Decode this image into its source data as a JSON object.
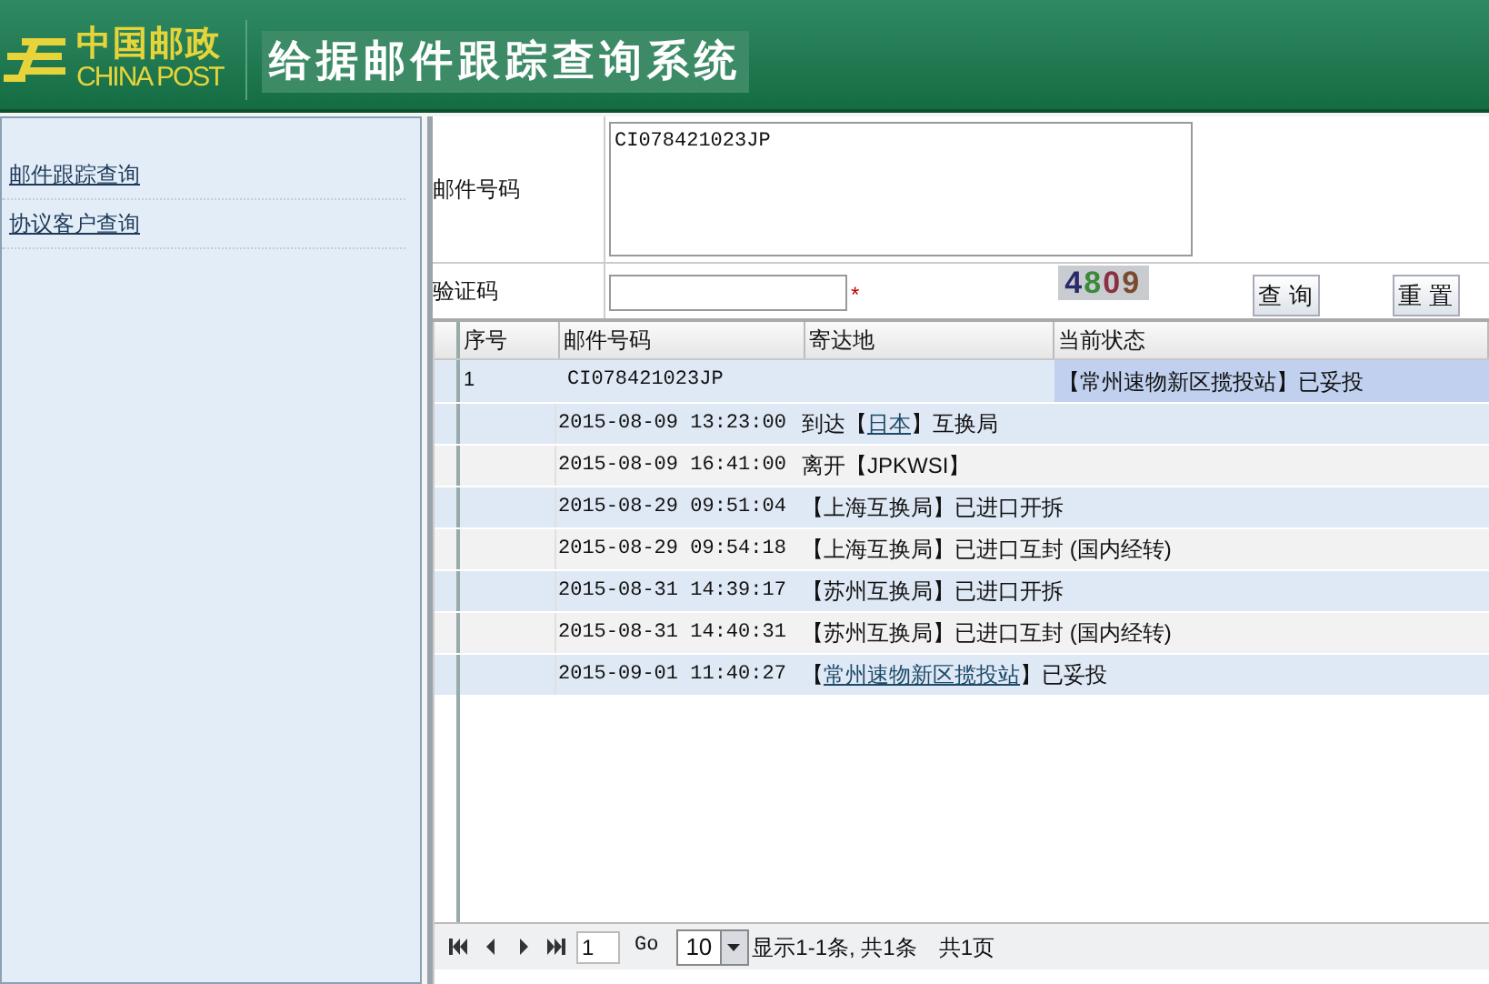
{
  "header": {
    "logo_cn": "中国邮政",
    "logo_en": "CHINA POST",
    "title": "给据邮件跟踪查询系统"
  },
  "sidebar": {
    "items": [
      {
        "label": "邮件跟踪查询"
      },
      {
        "label": "协议客户查询"
      }
    ]
  },
  "form": {
    "mail_label": "邮件号码",
    "mail_value": "CI078421023JP",
    "captcha_label": "验证码",
    "required_mark": "*",
    "captcha_digits": [
      {
        "text": "4",
        "color": "#2a2a6a"
      },
      {
        "text": "8",
        "color": "#3a8a3a"
      },
      {
        "text": "0",
        "color": "#8a3040"
      },
      {
        "text": "9",
        "color": "#7a4a30"
      }
    ],
    "buttons": [
      "查 询",
      "重 置"
    ]
  },
  "table": {
    "columns": [
      "序号",
      "邮件号码",
      "寄达地",
      "当前状态"
    ],
    "row": {
      "index": "1",
      "mail_no": "CI078421023JP",
      "status": "【常州速物新区揽投站】已妥投"
    },
    "events": [
      {
        "time": "2015-08-09 13:23:00",
        "parts": [
          {
            "text": "到达【",
            "link": false
          },
          {
            "text": "日本",
            "link": true
          },
          {
            "text": "】互换局",
            "link": false
          }
        ]
      },
      {
        "time": "2015-08-09 16:41:00",
        "parts": [
          {
            "text": "离开【JPKWSI】",
            "link": false
          }
        ]
      },
      {
        "time": "2015-08-29 09:51:04",
        "parts": [
          {
            "text": "【上海互换局】已进口开拆",
            "link": false
          }
        ]
      },
      {
        "time": "2015-08-29 09:54:18",
        "parts": [
          {
            "text": "【上海互换局】已进口互封 (国内经转)",
            "link": false
          }
        ]
      },
      {
        "time": "2015-08-31 14:39:17",
        "parts": [
          {
            "text": "【苏州互换局】已进口开拆",
            "link": false
          }
        ]
      },
      {
        "time": "2015-08-31 14:40:31",
        "parts": [
          {
            "text": "【苏州互换局】已进口互封 (国内经转)",
            "link": false
          }
        ]
      },
      {
        "time": "2015-09-01 11:40:27",
        "parts": [
          {
            "text": "【",
            "link": false
          },
          {
            "text": "常州速物新区揽投站",
            "link": true
          },
          {
            "text": "】已妥投",
            "link": false
          }
        ]
      }
    ]
  },
  "pager": {
    "page": "1",
    "go": "Go",
    "page_size": "10",
    "summary": "显示1-1条, 共1条",
    "pages": "共1页"
  }
}
